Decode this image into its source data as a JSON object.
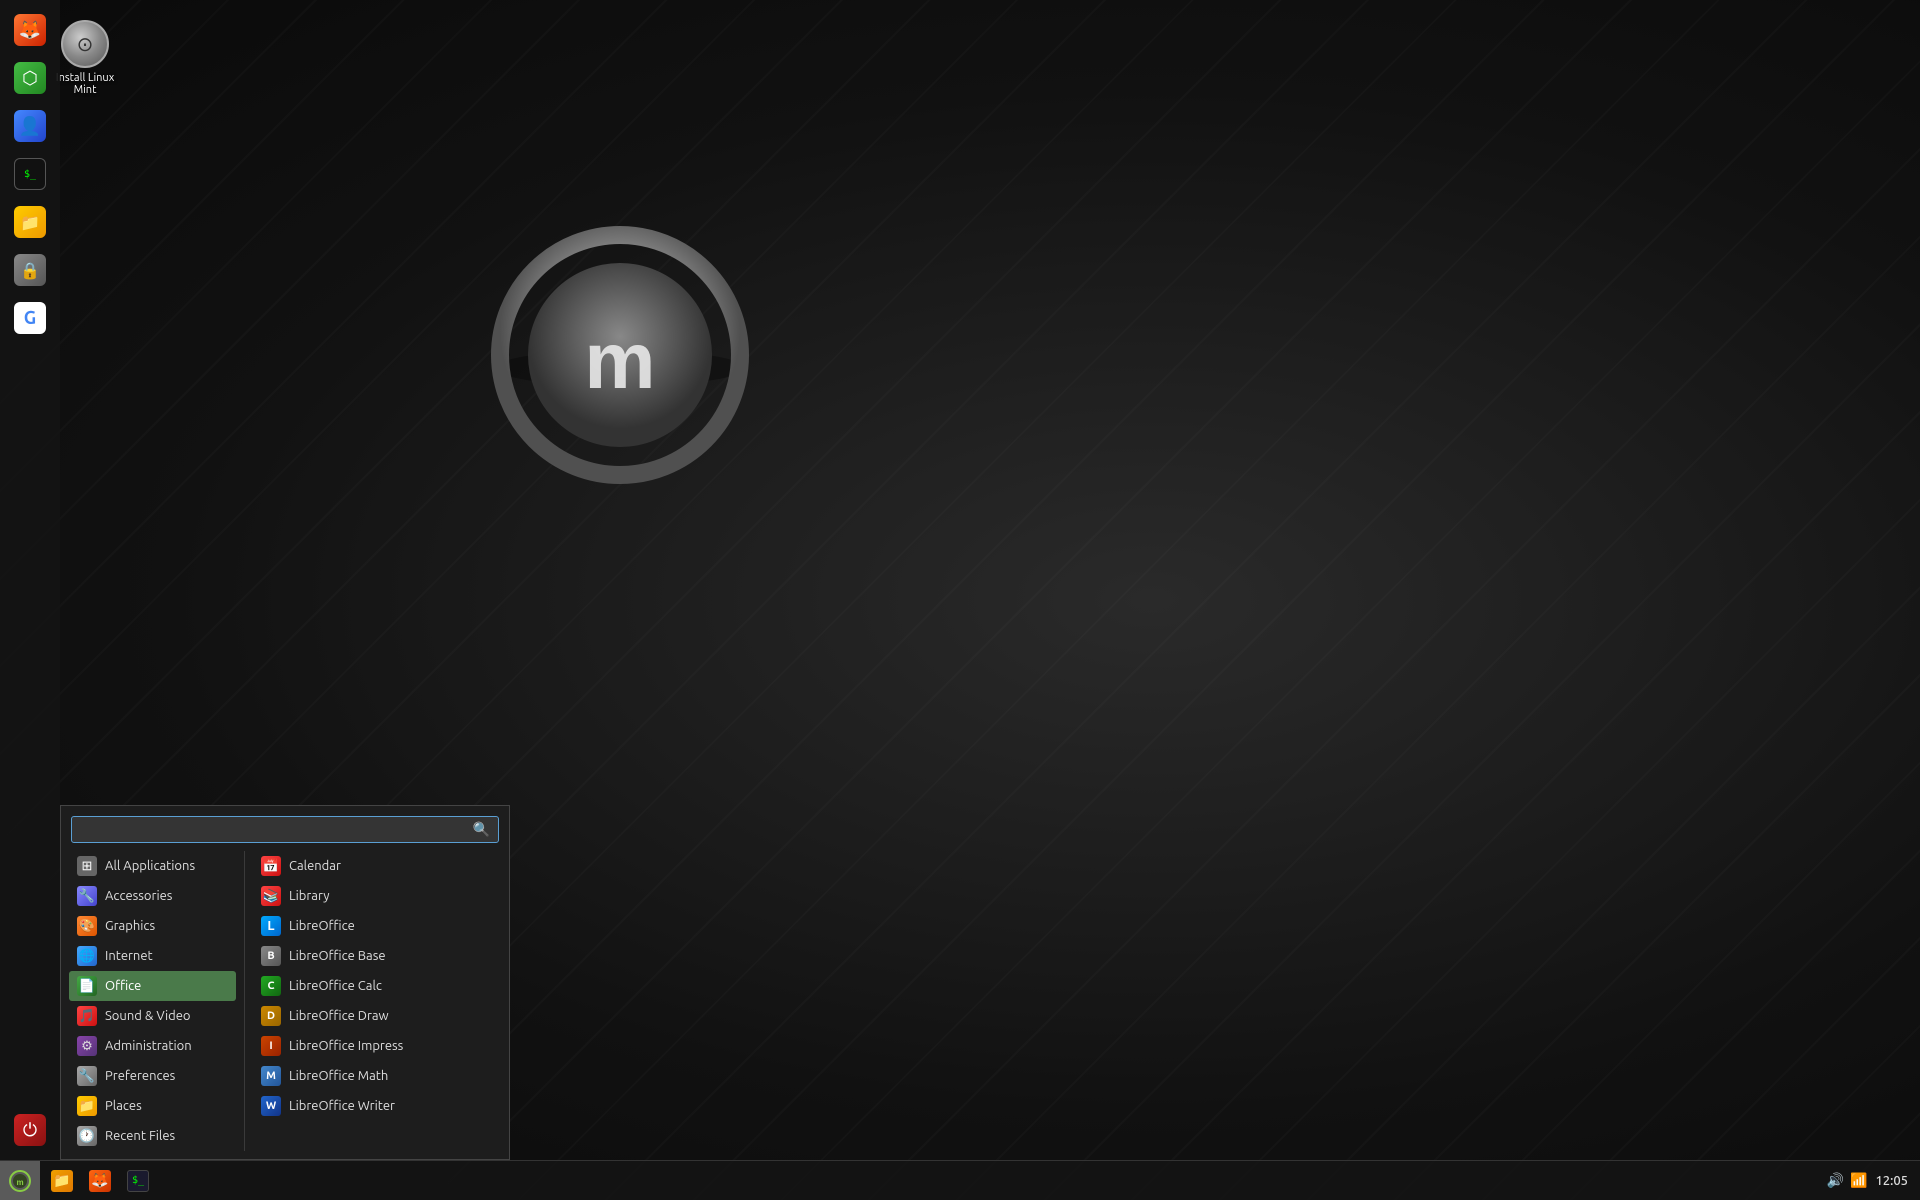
{
  "desktop": {
    "icon": {
      "label": "Install Linux Mint"
    }
  },
  "taskbar": {
    "clock": "12:05",
    "start_button": "☰",
    "apps": [
      {
        "name": "Files",
        "type": "files"
      },
      {
        "name": "Firefox",
        "type": "firefox"
      },
      {
        "name": "Terminal",
        "type": "terminal"
      }
    ]
  },
  "left_dock": {
    "icons": [
      {
        "name": "Firefox",
        "type": "firefox",
        "symbol": "🦊"
      },
      {
        "name": "Mint Tools",
        "type": "green",
        "symbol": "⬡"
      },
      {
        "name": "Account",
        "type": "blue",
        "symbol": "👤"
      },
      {
        "name": "Terminal",
        "type": "terminal",
        "symbol": ">_"
      },
      {
        "name": "Files",
        "type": "folder",
        "symbol": "📁"
      },
      {
        "name": "Lock",
        "type": "lock",
        "symbol": "🔒"
      },
      {
        "name": "Google",
        "type": "google",
        "symbol": "G"
      },
      {
        "name": "Power",
        "type": "power",
        "symbol": "⏻"
      }
    ]
  },
  "app_menu": {
    "search": {
      "placeholder": "",
      "value": ""
    },
    "left_items": [
      {
        "id": "all-applications",
        "label": "All Applications",
        "icon_type": "icon-grid",
        "symbol": "⊞"
      },
      {
        "id": "accessories",
        "label": "Accessories",
        "icon_type": "icon-accessories",
        "symbol": "🔧"
      },
      {
        "id": "graphics",
        "label": "Graphics",
        "icon_type": "icon-graphics",
        "symbol": "🎨"
      },
      {
        "id": "internet",
        "label": "Internet",
        "icon_type": "icon-internet",
        "symbol": "🌐"
      },
      {
        "id": "office",
        "label": "Office",
        "icon_type": "icon-office",
        "symbol": "📄",
        "active": true
      },
      {
        "id": "sound-video",
        "label": "Sound & Video",
        "icon_type": "icon-sound",
        "symbol": "🎵"
      },
      {
        "id": "administration",
        "label": "Administration",
        "icon_type": "icon-admin",
        "symbol": "⚙"
      },
      {
        "id": "preferences",
        "label": "Preferences",
        "icon_type": "icon-prefs",
        "symbol": "🔧"
      },
      {
        "id": "places",
        "label": "Places",
        "icon_type": "icon-places",
        "symbol": "📁"
      },
      {
        "id": "recent-files",
        "label": "Recent Files",
        "icon_type": "icon-recent",
        "symbol": "🕐"
      }
    ],
    "right_items": [
      {
        "id": "calendar",
        "label": "Calendar",
        "icon_type": "icon-calendar",
        "symbol": "📅"
      },
      {
        "id": "library",
        "label": "Library",
        "icon_type": "icon-library",
        "symbol": "📚"
      },
      {
        "id": "libreoffice",
        "label": "LibreOffice",
        "icon_type": "icon-libreoffice",
        "symbol": "L"
      },
      {
        "id": "lo-base",
        "label": "LibreOffice Base",
        "icon_type": "icon-lo-base",
        "symbol": "B"
      },
      {
        "id": "lo-calc",
        "label": "LibreOffice Calc",
        "icon_type": "icon-lo-calc",
        "symbol": "C"
      },
      {
        "id": "lo-draw",
        "label": "LibreOffice Draw",
        "icon_type": "icon-lo-draw",
        "symbol": "D"
      },
      {
        "id": "lo-impress",
        "label": "LibreOffice Impress",
        "icon_type": "icon-lo-impress",
        "symbol": "I"
      },
      {
        "id": "lo-math",
        "label": "LibreOffice Math",
        "icon_type": "icon-lo-math",
        "symbol": "M"
      },
      {
        "id": "lo-writer",
        "label": "LibreOffice Writer",
        "icon_type": "icon-lo-writer",
        "symbol": "W"
      }
    ]
  }
}
